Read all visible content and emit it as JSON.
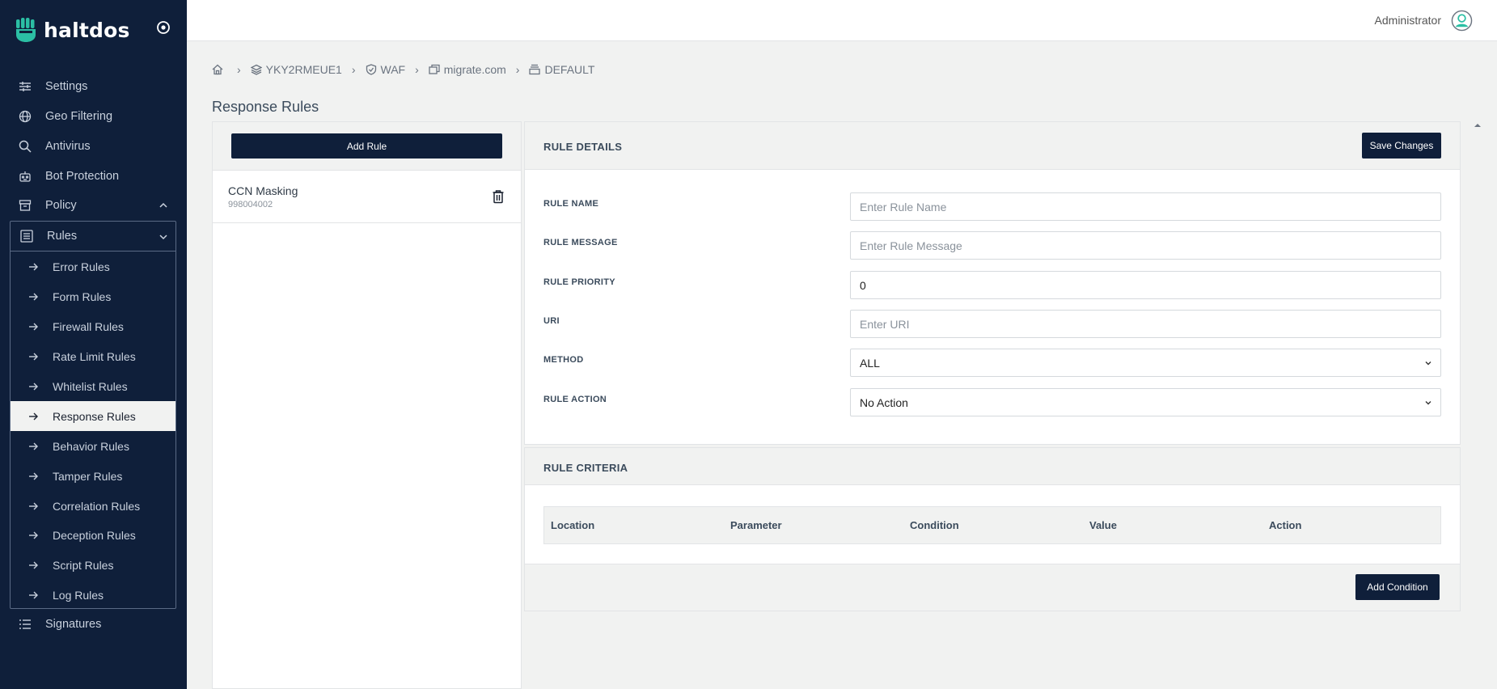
{
  "brand": {
    "name": "haltdos",
    "accent": "#2bbfa4"
  },
  "sidebar": {
    "items_top": [
      {
        "label": "Settings",
        "icon": "sliders-icon"
      },
      {
        "label": "Geo Filtering",
        "icon": "globe-icon"
      },
      {
        "label": "Antivirus",
        "icon": "search-icon"
      },
      {
        "label": "Bot Protection",
        "icon": "robot-icon"
      },
      {
        "label": "Policy",
        "icon": "archive-icon"
      }
    ],
    "rules_label": "Rules",
    "sub_items": [
      "Error Rules",
      "Form Rules",
      "Firewall Rules",
      "Rate Limit Rules",
      "Whitelist Rules",
      "Response Rules",
      "Behavior Rules",
      "Tamper Rules",
      "Correlation Rules",
      "Deception Rules",
      "Script Rules",
      "Log Rules"
    ],
    "active_sub": "Response Rules",
    "signatures_label": "Signatures"
  },
  "topbar": {
    "user": "Administrator"
  },
  "breadcrumb": [
    "YKY2RMEUE1",
    "WAF",
    "migrate.com",
    "DEFAULT"
  ],
  "page": {
    "title": "Response Rules"
  },
  "list": {
    "add_label": "Add Rule",
    "rules": [
      {
        "name": "CCN Masking",
        "id": "998004002"
      }
    ]
  },
  "details": {
    "title": "RULE DETAILS",
    "save_label": "Save Changes",
    "fields": {
      "name": {
        "label": "RULE NAME",
        "placeholder": "Enter Rule Name",
        "value": ""
      },
      "message": {
        "label": "RULE MESSAGE",
        "placeholder": "Enter Rule Message",
        "value": ""
      },
      "priority": {
        "label": "RULE PRIORITY",
        "value": "0"
      },
      "uri": {
        "label": "URI",
        "placeholder": "Enter URI",
        "value": ""
      },
      "method": {
        "label": "METHOD",
        "value": "ALL"
      },
      "action": {
        "label": "RULE ACTION",
        "value": "No Action"
      }
    }
  },
  "criteria": {
    "title": "RULE CRITERIA",
    "columns": [
      "Location",
      "Parameter",
      "Condition",
      "Value",
      "Action"
    ],
    "add_label": "Add Condition"
  }
}
